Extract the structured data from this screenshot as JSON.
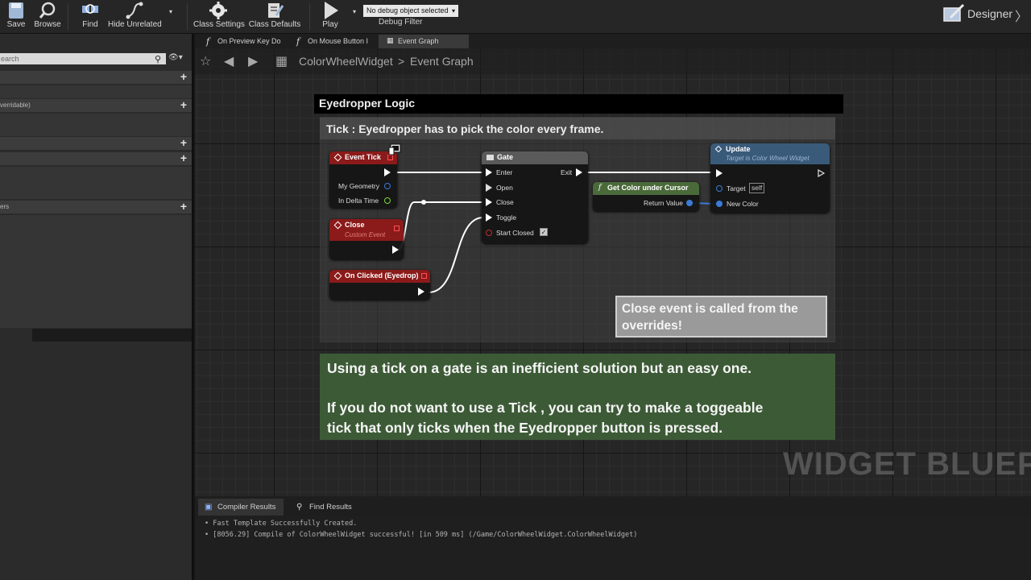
{
  "toolbar": {
    "save": "Save",
    "browse": "Browse",
    "find": "Find",
    "hide_unrelated": "Hide Unrelated",
    "class_settings": "Class Settings",
    "class_defaults": "Class Defaults",
    "play": "Play",
    "debug_select": "No debug object selected",
    "debug_filter": "Debug Filter",
    "designer": "Designer"
  },
  "left_panel": {
    "search_placeholder": "earch",
    "row_overridable": "verridable)",
    "row_ers": "ers"
  },
  "tabs": [
    {
      "label": "On Preview Key Do"
    },
    {
      "label": "On Mouse Button I"
    },
    {
      "label": "Event Graph"
    }
  ],
  "breadcrumb": {
    "widget": "ColorWheelWidget",
    "separator": ">",
    "graph": "Event Graph"
  },
  "comment": {
    "header": "Eyedropper Logic",
    "title": "Tick : Eyedropper has to pick the color every frame."
  },
  "nodes": {
    "event_tick": {
      "title": "Event Tick",
      "pin_geometry": "My Geometry",
      "pin_delta": "In Delta Time"
    },
    "close": {
      "title": "Close",
      "subtitle": "Custom Event"
    },
    "on_clicked": {
      "title": "On Clicked (Eyedrop)"
    },
    "gate": {
      "title": "Gate",
      "enter": "Enter",
      "open": "Open",
      "close": "Close",
      "toggle": "Toggle",
      "start_closed": "Start Closed",
      "exit": "Exit"
    },
    "get_color": {
      "title": "Get Color under Cursor",
      "return_value": "Return Value"
    },
    "update": {
      "title": "Update",
      "subtitle": "Target is Color Wheel Widget",
      "target": "Target",
      "target_value": "self",
      "new_color": "New Color"
    }
  },
  "notes": {
    "gray": "Close event is called from the overrides!",
    "green_line1": "Using a tick on a gate is an inefficient solution but an easy one.",
    "green_line2": "If you do not want to use a Tick , you can try to make a toggeable",
    "green_line3": "tick that only ticks when the Eyedropper button is pressed."
  },
  "watermark": "WIDGET BLUEPR",
  "bottom_tabs": [
    {
      "label": "Compiler Results"
    },
    {
      "label": "Find Results"
    }
  ],
  "output": {
    "line1": "• Fast Template Successfully Created.",
    "line2": "• [8056.29] Compile of ColorWheelWidget successful! [in 509 ms] (/Game/ColorWheelWidget.ColorWheelWidget)"
  },
  "colors": {
    "event_red": "#8b1a1a",
    "gate_header": "#5a5a5a",
    "function_green": "#4a6a3a",
    "update_blue": "#3a5a7a",
    "note_green": "#3c5a36",
    "pin_blue": "#3b7bd6",
    "pin_green": "#7bd63b"
  }
}
